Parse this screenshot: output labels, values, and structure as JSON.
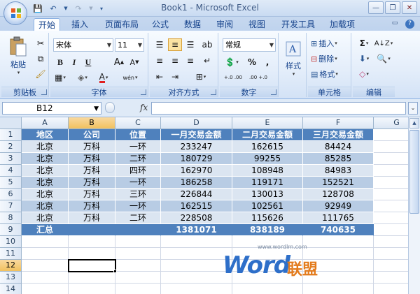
{
  "window": {
    "title": "Book1 - Microsoft Excel",
    "controls": [
      "minimize",
      "restore",
      "close"
    ]
  },
  "quick_access": [
    "save-icon",
    "undo-icon",
    "redo-icon",
    "customize-icon"
  ],
  "tabs": [
    "开始",
    "插入",
    "页面布局",
    "公式",
    "数据",
    "审阅",
    "视图",
    "开发工具",
    "加载项"
  ],
  "active_tab": "开始",
  "ribbon": {
    "clipboard": {
      "label": "剪贴板",
      "paste": "粘贴"
    },
    "font": {
      "label": "字体",
      "font_name": "宋体",
      "font_size": "11",
      "bold": "B",
      "italic": "I",
      "underline": "U",
      "font_color_letter": "A",
      "phonetic": "wén"
    },
    "alignment": {
      "label": "对齐方式"
    },
    "number": {
      "label": "数字",
      "format": "常规",
      "percent": "%",
      "comma": ",",
      "increase_decimal": "+.0 .00",
      "decrease_decimal": ".00 +.0"
    },
    "styles": {
      "label": "样式"
    },
    "cells": {
      "label": "单元格",
      "insert": "插入",
      "delete": "删除",
      "format": "格式"
    },
    "editing": {
      "label": "编辑"
    }
  },
  "formula_bar": {
    "name_box": "B12",
    "fx": "fx",
    "formula": ""
  },
  "columns": [
    "A",
    "B",
    "C",
    "D",
    "E",
    "F",
    "G"
  ],
  "rows": [
    "1",
    "2",
    "3",
    "4",
    "5",
    "6",
    "7",
    "8",
    "9",
    "10",
    "11",
    "12",
    "13",
    "14"
  ],
  "selected_cell": {
    "column": "B",
    "row": "12"
  },
  "table": {
    "headers": [
      "地区",
      "公司",
      "位置",
      "一月交易金额",
      "二月交易金额",
      "三月交易金额"
    ],
    "rows": [
      [
        "北京",
        "万科",
        "一环",
        "233247",
        "162615",
        "84424"
      ],
      [
        "北京",
        "万科",
        "二环",
        "180729",
        "99255",
        "85285"
      ],
      [
        "北京",
        "万科",
        "四环",
        "162970",
        "108948",
        "84983"
      ],
      [
        "北京",
        "万科",
        "一环",
        "186258",
        "119171",
        "152521"
      ],
      [
        "北京",
        "万科",
        "三环",
        "226844",
        "130013",
        "128708"
      ],
      [
        "北京",
        "万科",
        "一环",
        "162515",
        "102561",
        "92949"
      ],
      [
        "北京",
        "万科",
        "二环",
        "228508",
        "115626",
        "111765"
      ]
    ],
    "total": [
      "汇总",
      "",
      "",
      "1381071",
      "838189",
      "740635"
    ]
  },
  "watermark": {
    "url": "www.wordlm.com",
    "logo": "Word",
    "logo_cn": "联盟"
  },
  "colors": {
    "table_header": "#4f81bd",
    "band_light": "#dbe5f1",
    "band_dark": "#b8cce4",
    "watermark_blue": "#2e6fc9",
    "watermark_orange": "#e37b1c"
  }
}
